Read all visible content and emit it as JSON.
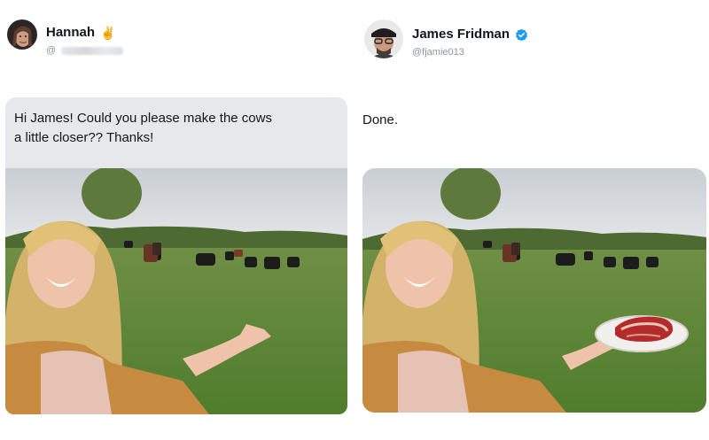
{
  "left_tweet": {
    "author_name": "Hannah",
    "author_emoji": "✌",
    "handle_prefix": "@",
    "text_line1": "Hi James! Could you please make the cows",
    "text_line2": "a little closer?? Thanks!"
  },
  "right_tweet": {
    "author_name": "James Fridman",
    "handle": "@fjamie013",
    "text": "Done."
  },
  "icons": {
    "verified_badge": "verified-check-icon",
    "peace_emoji": "victory-hand-emoji"
  },
  "colors": {
    "verified_blue": "#1d9bf0",
    "bubble_bg": "#e6e8ec",
    "handle_gray": "#8f959a"
  }
}
